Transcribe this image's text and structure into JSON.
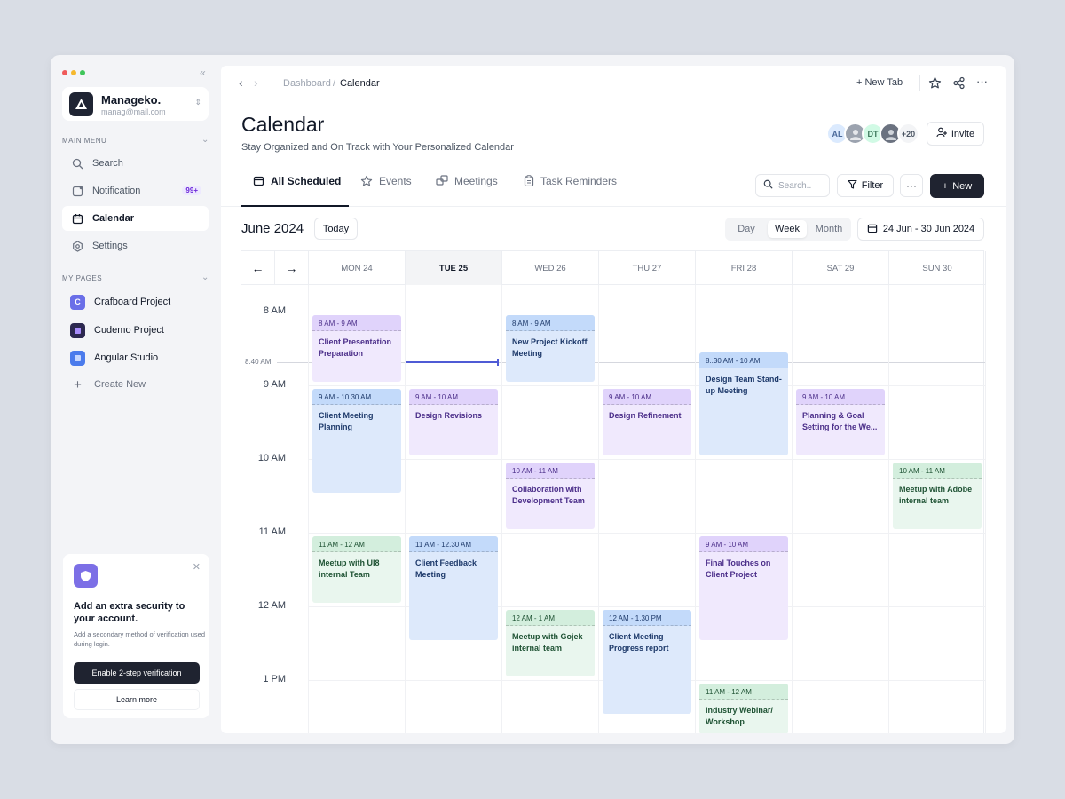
{
  "sidebar": {
    "workspace": {
      "name": "Manageko.",
      "email": "manag@mail.com"
    },
    "main_menu_label": "MAIN MENU",
    "menu": [
      {
        "label": "Search",
        "icon": "search-icon"
      },
      {
        "label": "Notification",
        "icon": "bell-icon",
        "badge": "99+"
      },
      {
        "label": "Calendar",
        "icon": "calendar-icon",
        "active": true
      },
      {
        "label": "Settings",
        "icon": "gear-icon"
      }
    ],
    "my_pages_label": "MY PAGES",
    "pages": [
      {
        "label": "Crafboard Project",
        "letter": "C",
        "color": "#6a6fe8"
      },
      {
        "label": "Cudemo Project",
        "letter": "",
        "color": "#2c2850"
      },
      {
        "label": "Angular Studio",
        "letter": "",
        "color": "#4b7bec"
      }
    ],
    "create_new": "Create New",
    "security_card": {
      "title": "Add an extra security to your account.",
      "description": "Add a secondary method of verification used during login.",
      "primary_button": "Enable 2-step verification",
      "secondary_button": "Learn more"
    }
  },
  "topbar": {
    "breadcrumb": [
      "Dashboard",
      "Calendar"
    ],
    "breadcrumb_sep": "/",
    "new_tab": "New Tab"
  },
  "header": {
    "title": "Calendar",
    "subtitle": "Stay Organized and On Track with Your Personalized Calendar",
    "avatars": [
      {
        "initials": "AL",
        "bg": "#dbeafe",
        "fg": "#4b6a9b"
      },
      {
        "initials": "",
        "bg": "#9ca3af",
        "fg": "#fff"
      },
      {
        "initials": "DT",
        "bg": "#d1fae5",
        "fg": "#3f7a5d"
      },
      {
        "initials": "",
        "bg": "#6b7280",
        "fg": "#fff"
      },
      {
        "initials": "+20",
        "bg": "#f3f4f6",
        "fg": "#4b5563"
      }
    ],
    "invite_label": "Invite"
  },
  "tabs": [
    {
      "label": "All Scheduled",
      "icon": "calendar-icon",
      "active": true
    },
    {
      "label": "Events",
      "icon": "star-icon"
    },
    {
      "label": "Meetings",
      "icon": "meeting-icon"
    },
    {
      "label": "Task Reminders",
      "icon": "clipboard-icon"
    }
  ],
  "toolbar": {
    "search_placeholder": "Search..",
    "filter_label": "Filter",
    "more_label": "···",
    "new_label": "New"
  },
  "calendar": {
    "month_label": "June 2024",
    "today_label": "Today",
    "views": [
      "Day",
      "Week",
      "Month"
    ],
    "active_view": "Week",
    "date_range": "24 Jun - 30 Jun 2024",
    "days": [
      "MON 24",
      "TUE 25",
      "WED 26",
      "THU 27",
      "FRI 28",
      "SAT 29",
      "SUN 30"
    ],
    "today_index": 1,
    "hours": [
      "8 AM",
      "9 AM",
      "10 AM",
      "11 AM",
      "12 AM",
      "1 PM"
    ],
    "now_label": "8.40 AM",
    "events": [
      {
        "day": 0,
        "start": 8.0,
        "end": 9.0,
        "time": "8 AM - 9 AM",
        "title": "Client Presentation Preparation",
        "color": "purple"
      },
      {
        "day": 2,
        "start": 8.0,
        "end": 9.0,
        "time": "8 AM - 9 AM",
        "title": "New Project Kickoff Meeting",
        "color": "blue"
      },
      {
        "day": 4,
        "start": 8.5,
        "end": 10.0,
        "time": "8..30 AM - 10 AM",
        "title": "Design Team Stand-up Meeting",
        "color": "blue"
      },
      {
        "day": 0,
        "start": 9.0,
        "end": 10.5,
        "time": "9 AM - 10.30 AM",
        "title": "Client Meeting Planning",
        "color": "blue"
      },
      {
        "day": 1,
        "start": 9.0,
        "end": 10.0,
        "time": "9 AM - 10 AM",
        "title": "Design Revisions",
        "color": "purple"
      },
      {
        "day": 3,
        "start": 9.0,
        "end": 10.0,
        "time": "9 AM - 10 AM",
        "title": "Design Refinement",
        "color": "purple"
      },
      {
        "day": 5,
        "start": 9.0,
        "end": 10.0,
        "time": "9 AM - 10 AM",
        "title": "Planning & Goal Setting for the We...",
        "color": "purple"
      },
      {
        "day": 2,
        "start": 10.0,
        "end": 11.0,
        "time": "10 AM - 11 AM",
        "title": "Collaboration with Development Team",
        "color": "purple"
      },
      {
        "day": 6,
        "start": 10.0,
        "end": 11.0,
        "time": "10 AM - 11 AM",
        "title": "Meetup with Adobe internal team",
        "color": "green"
      },
      {
        "day": 0,
        "start": 11.0,
        "end": 12.0,
        "time": "11 AM - 12 AM",
        "title": "Meetup with UI8 internal Team",
        "color": "green"
      },
      {
        "day": 1,
        "start": 11.0,
        "end": 12.5,
        "time": "11 AM - 12.30 AM",
        "title": "Client Feedback Meeting",
        "color": "blue"
      },
      {
        "day": 4,
        "start": 11.0,
        "end": 12.5,
        "time": "9 AM - 10 AM",
        "title": "Final Touches on Client Project",
        "color": "purple"
      },
      {
        "day": 2,
        "start": 12.0,
        "end": 13.0,
        "time": "12 AM - 1 AM",
        "title": "Meetup with Gojek internal team",
        "color": "green"
      },
      {
        "day": 3,
        "start": 12.0,
        "end": 13.5,
        "time": "12 AM - 1.30 PM",
        "title": "Client Meeting Progress report",
        "color": "blue"
      },
      {
        "day": 4,
        "start": 13.0,
        "end": 14.0,
        "time": "11 AM - 12 AM",
        "title": "Industry Webinar/ Workshop",
        "color": "green"
      }
    ]
  }
}
